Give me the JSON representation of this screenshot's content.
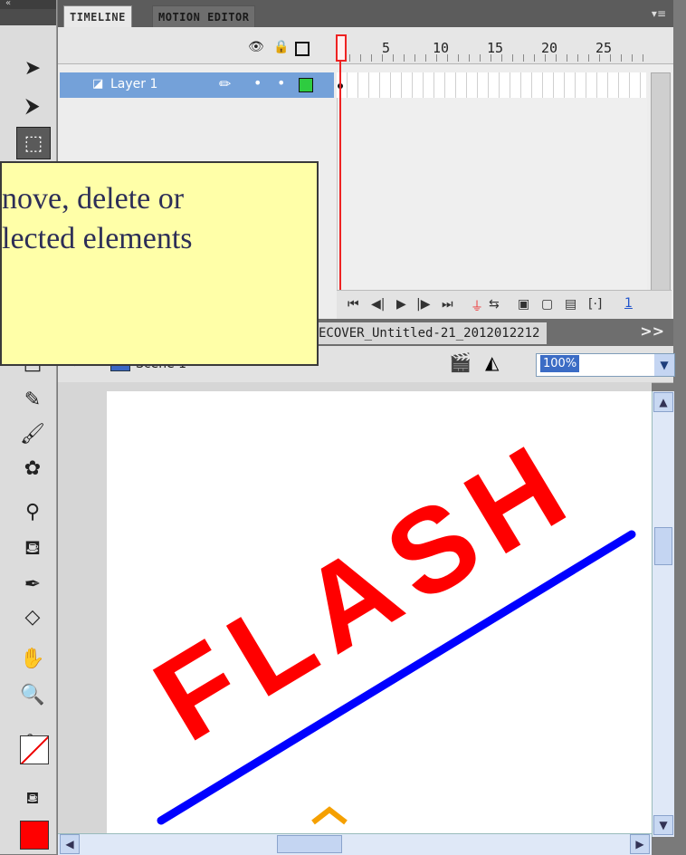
{
  "timeline": {
    "tabs": [
      "TIMELINE",
      "MOTION EDITOR"
    ],
    "frame_numbers": [
      "5",
      "10",
      "15",
      "20",
      "25"
    ],
    "layer": {
      "name": "Layer 1"
    },
    "frame_counter": "1"
  },
  "document": {
    "tab": "ECOVER_Untitled-21_2012012212",
    "more": ">>"
  },
  "editbar": {
    "scene": "Scene 1",
    "zoom": "100%"
  },
  "stage": {
    "text": "FLASH",
    "text_color": "#ff0000",
    "line_color": "#0000ff"
  },
  "callout": {
    "line1": "nove, delete or",
    "line2": "lected elements"
  },
  "tools": [
    "selection-tool",
    "subselection-tool",
    "free-transform-tool",
    "rectangle-tool",
    "pencil-tool",
    "brush-tool",
    "deco-tool",
    "bone-tool",
    "paint-bucket-tool",
    "eyedropper-tool",
    "eraser-tool",
    "hand-tool",
    "zoom-tool",
    "stroke-color",
    "fill-color"
  ]
}
